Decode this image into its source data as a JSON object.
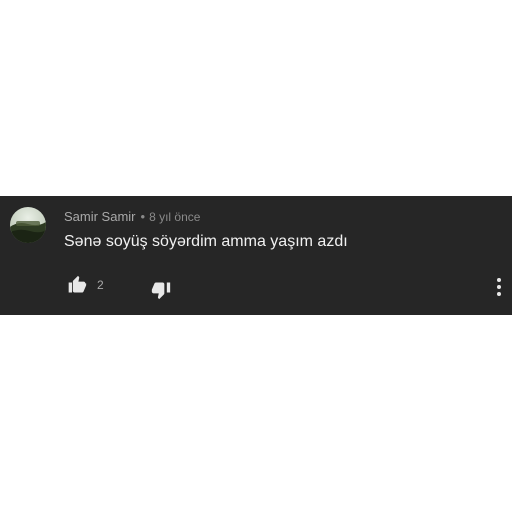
{
  "comment": {
    "author": "Samir Samir",
    "separator": "•",
    "time": "8 yıl önce",
    "text": "Sənə soyüş söyərdim amma yaşım azdı",
    "like_count": "2"
  },
  "icons": {
    "like": "thumbs-up-icon",
    "dislike": "thumbs-down-icon",
    "menu": "more-vertical-icon"
  },
  "colors": {
    "background": "#262626",
    "text": "#f1f1f1",
    "muted": "#a9a9a9"
  }
}
